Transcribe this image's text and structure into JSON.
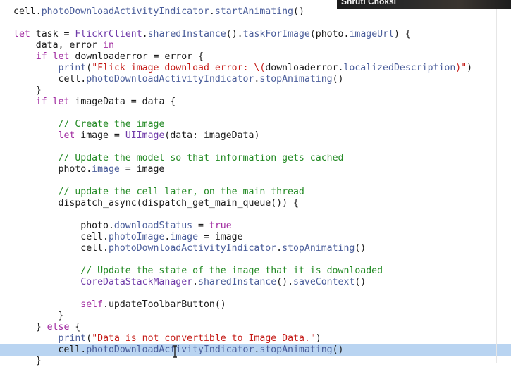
{
  "video_overlay": {
    "presenter_name": "Shruti Choksi"
  },
  "editor": {
    "highlighted_line": 30,
    "lines": [
      [
        [
          "cell.",
          "plain"
        ],
        [
          "photoDownloadActivityIndicator",
          "prop"
        ],
        [
          ".",
          "plain"
        ],
        [
          "startAnimating",
          "prop"
        ],
        [
          "()",
          "plain"
        ]
      ],
      [],
      [
        [
          "let",
          "kw"
        ],
        [
          " task = ",
          "plain"
        ],
        [
          "FlickrClient",
          "type"
        ],
        [
          ".",
          "plain"
        ],
        [
          "sharedInstance",
          "prop"
        ],
        [
          "().",
          "plain"
        ],
        [
          "taskForImage",
          "prop"
        ],
        [
          "(photo.",
          "plain"
        ],
        [
          "imageUrl",
          "prop"
        ],
        [
          ") {",
          "plain"
        ]
      ],
      [
        [
          "    data, error ",
          "plain"
        ],
        [
          "in",
          "kw"
        ]
      ],
      [
        [
          "    ",
          "plain"
        ],
        [
          "if",
          "kw"
        ],
        [
          " ",
          "plain"
        ],
        [
          "let",
          "kw"
        ],
        [
          " downloaderror = error {",
          "plain"
        ]
      ],
      [
        [
          "        ",
          "plain"
        ],
        [
          "print",
          "prop"
        ],
        [
          "(",
          "plain"
        ],
        [
          "\"Flick image download error: \\(",
          "str"
        ],
        [
          "downloaderror.",
          "plain"
        ],
        [
          "localizedDescription",
          "prop"
        ],
        [
          ")\"",
          "str"
        ],
        [
          ")",
          "plain"
        ]
      ],
      [
        [
          "        cell.",
          "plain"
        ],
        [
          "photoDownloadActivityIndicator",
          "prop"
        ],
        [
          ".",
          "plain"
        ],
        [
          "stopAnimating",
          "prop"
        ],
        [
          "()",
          "plain"
        ]
      ],
      [
        [
          "    }",
          "plain"
        ]
      ],
      [
        [
          "    ",
          "plain"
        ],
        [
          "if",
          "kw"
        ],
        [
          " ",
          "plain"
        ],
        [
          "let",
          "kw"
        ],
        [
          " imageData = data {",
          "plain"
        ]
      ],
      [],
      [
        [
          "        ",
          "plain"
        ],
        [
          "// Create the image",
          "cmt"
        ]
      ],
      [
        [
          "        ",
          "plain"
        ],
        [
          "let",
          "kw"
        ],
        [
          " image = ",
          "plain"
        ],
        [
          "UIImage",
          "type"
        ],
        [
          "(data: imageData)",
          "plain"
        ]
      ],
      [],
      [
        [
          "        ",
          "plain"
        ],
        [
          "// Update the model so that information gets cached",
          "cmt"
        ]
      ],
      [
        [
          "        photo.",
          "plain"
        ],
        [
          "image",
          "prop"
        ],
        [
          " = image",
          "plain"
        ]
      ],
      [],
      [
        [
          "        ",
          "plain"
        ],
        [
          "// update the cell later, on the main thread",
          "cmt"
        ]
      ],
      [
        [
          "        dispatch_async(dispatch_get_main_queue()) {",
          "plain"
        ]
      ],
      [],
      [
        [
          "            photo.",
          "plain"
        ],
        [
          "downloadStatus",
          "prop"
        ],
        [
          " = ",
          "plain"
        ],
        [
          "true",
          "kw"
        ]
      ],
      [
        [
          "            cell.",
          "plain"
        ],
        [
          "photoImage",
          "prop"
        ],
        [
          ".",
          "plain"
        ],
        [
          "image",
          "prop"
        ],
        [
          " = image",
          "plain"
        ]
      ],
      [
        [
          "            cell.",
          "plain"
        ],
        [
          "photoDownloadActivityIndicator",
          "prop"
        ],
        [
          ".",
          "plain"
        ],
        [
          "stopAnimating",
          "prop"
        ],
        [
          "()",
          "plain"
        ]
      ],
      [],
      [
        [
          "            ",
          "plain"
        ],
        [
          "// Update the state of the image that it is downloaded",
          "cmt"
        ]
      ],
      [
        [
          "            ",
          "plain"
        ],
        [
          "CoreDataStackManager",
          "type"
        ],
        [
          ".",
          "plain"
        ],
        [
          "sharedInstance",
          "prop"
        ],
        [
          "().",
          "plain"
        ],
        [
          "saveContext",
          "prop"
        ],
        [
          "()",
          "plain"
        ]
      ],
      [],
      [
        [
          "            ",
          "plain"
        ],
        [
          "self",
          "kw"
        ],
        [
          ".updateToolbarButton()",
          "plain"
        ]
      ],
      [
        [
          "        }",
          "plain"
        ]
      ],
      [
        [
          "    } ",
          "plain"
        ],
        [
          "else",
          "kw"
        ],
        [
          " {",
          "plain"
        ]
      ],
      [
        [
          "        ",
          "plain"
        ],
        [
          "print",
          "prop"
        ],
        [
          "(",
          "plain"
        ],
        [
          "\"Data is not convertible to Image Data.\"",
          "str"
        ],
        [
          ")",
          "plain"
        ]
      ],
      [
        [
          "        cell.",
          "plain"
        ],
        [
          "photoDownloadActivityIndicator",
          "prop"
        ],
        [
          ".",
          "plain"
        ],
        [
          "stopAnimating",
          "prop"
        ],
        [
          "()",
          "plain"
        ]
      ],
      [
        [
          "    }",
          "plain"
        ]
      ]
    ]
  }
}
